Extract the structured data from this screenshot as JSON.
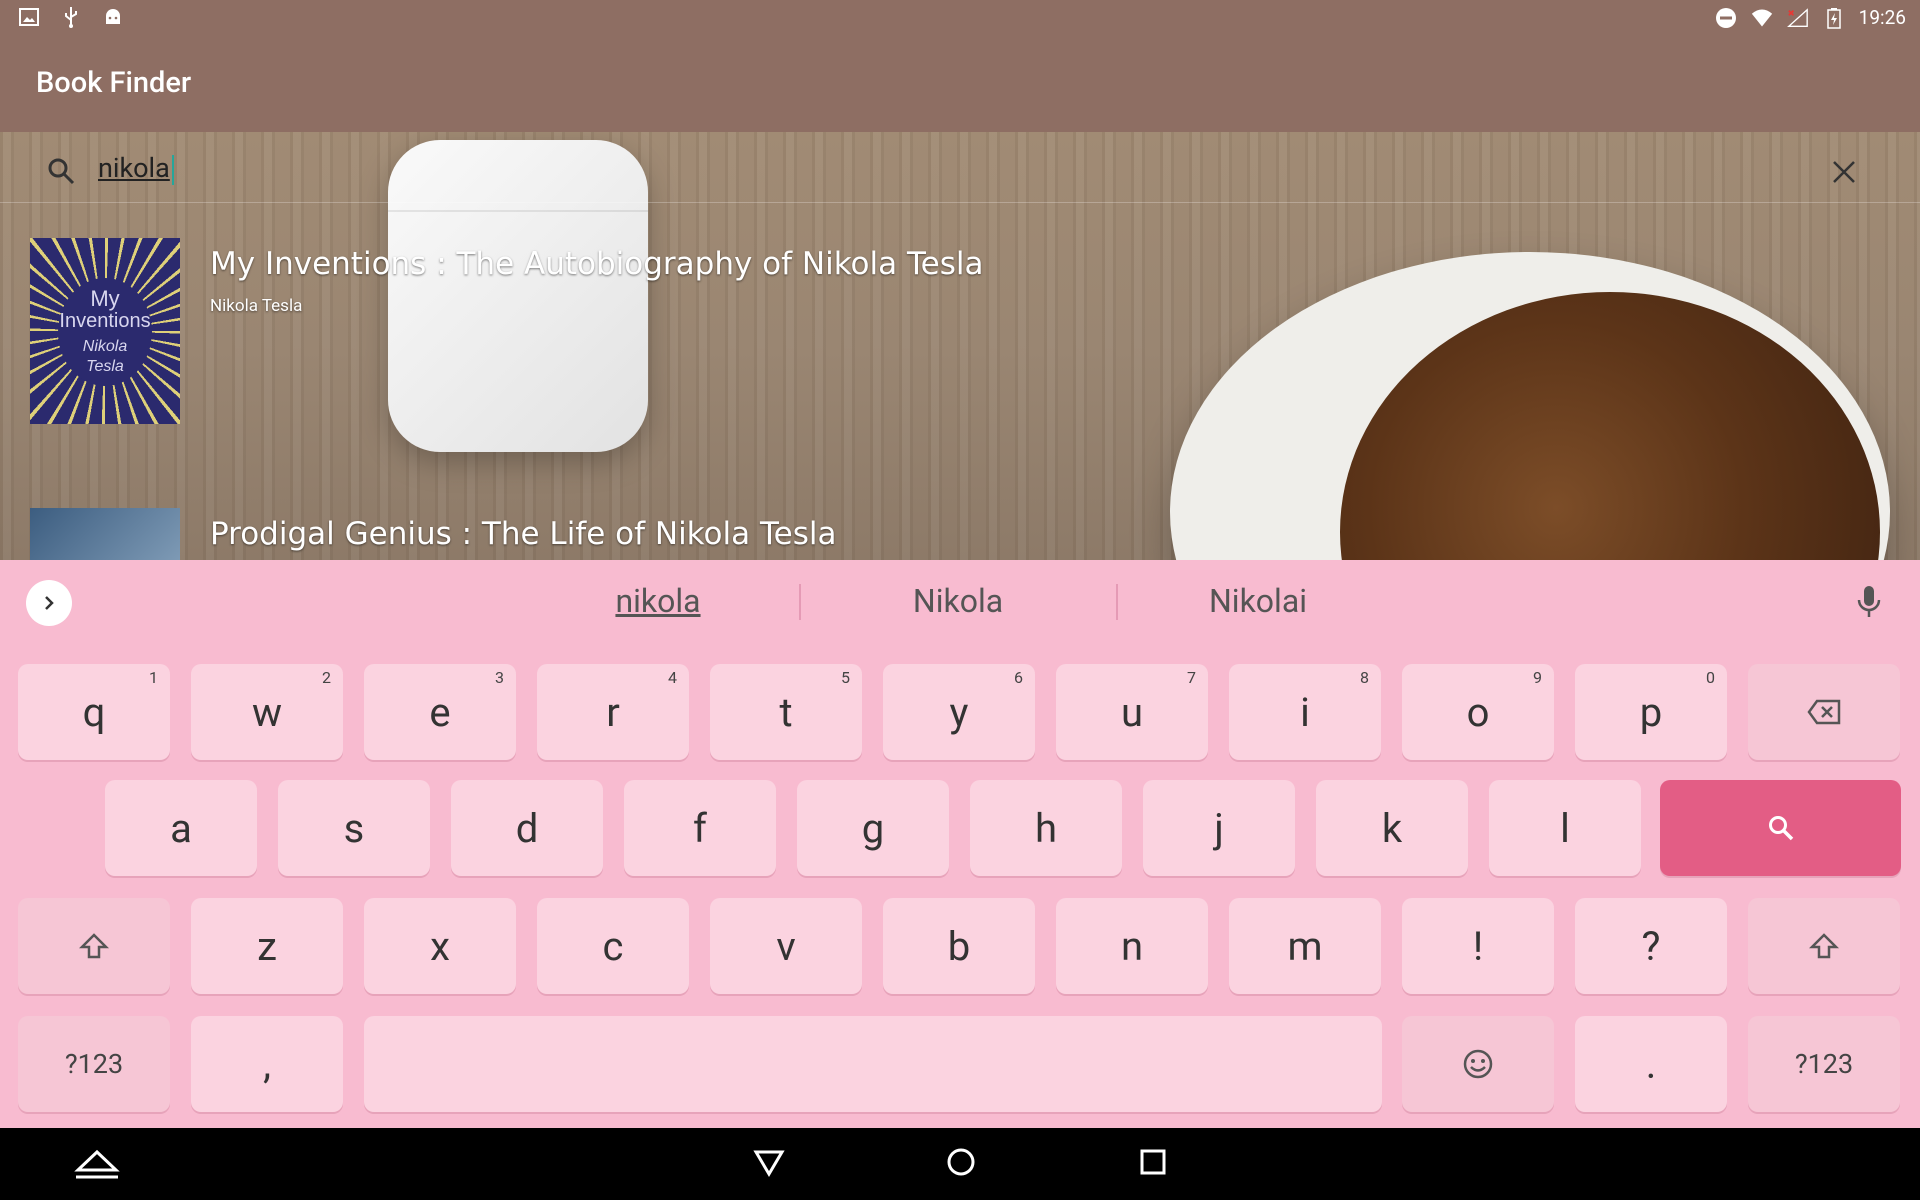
{
  "status_bar": {
    "time": "19:26"
  },
  "app": {
    "title": "Book Finder"
  },
  "search": {
    "query": "nikola"
  },
  "results": [
    {
      "title": "My Inventions : The Autobiography of Nikola Tesla",
      "author": "Nikola Tesla",
      "cover_lines": [
        "My",
        "Inventions",
        "Nikola",
        "Tesla"
      ]
    },
    {
      "title": "Prodigal Genius : The Life of Nikola Tesla",
      "author": ""
    }
  ],
  "suggestions": [
    "nikola",
    "Nikola",
    "Nikolai"
  ],
  "keyboard": {
    "row1": [
      {
        "key": "q",
        "hint": "1"
      },
      {
        "key": "w",
        "hint": "2"
      },
      {
        "key": "e",
        "hint": "3"
      },
      {
        "key": "r",
        "hint": "4"
      },
      {
        "key": "t",
        "hint": "5"
      },
      {
        "key": "y",
        "hint": "6"
      },
      {
        "key": "u",
        "hint": "7"
      },
      {
        "key": "i",
        "hint": "8"
      },
      {
        "key": "o",
        "hint": "9"
      },
      {
        "key": "p",
        "hint": "0"
      }
    ],
    "row2": [
      "a",
      "s",
      "d",
      "f",
      "g",
      "h",
      "j",
      "k",
      "l"
    ],
    "row3": [
      "z",
      "x",
      "c",
      "v",
      "b",
      "n",
      "m",
      "!",
      "?"
    ],
    "symbols_label": "?123",
    "comma": ",",
    "period": "."
  },
  "colors": {
    "app_bar": "#8e6e63",
    "keyboard_bg": "#f8bbd0",
    "key": "#fbd3e0",
    "search_key": "#e35d85"
  }
}
